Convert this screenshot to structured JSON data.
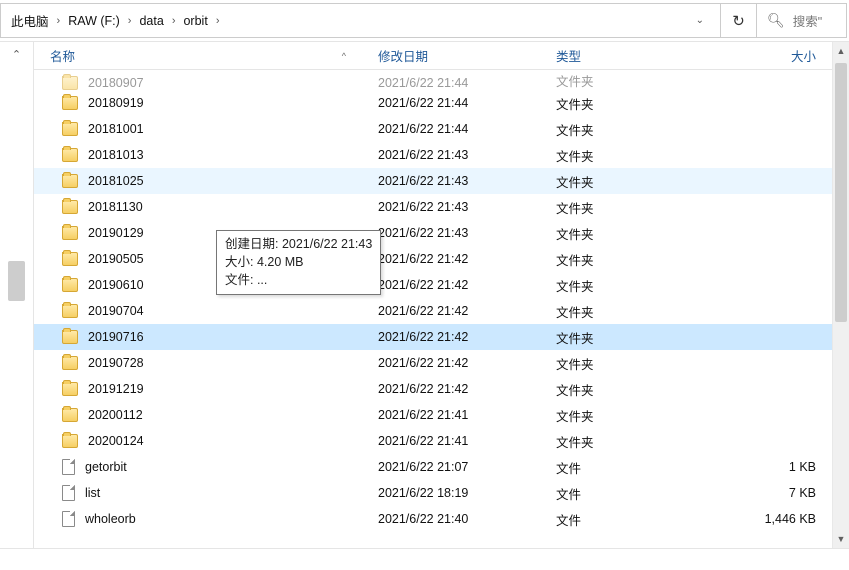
{
  "breadcrumb": {
    "items": [
      "此电脑",
      "RAW (F:)",
      "data",
      "orbit"
    ],
    "separator": "›"
  },
  "toolbar": {
    "refresh_icon": "refresh-icon",
    "search_placeholder": "搜索\""
  },
  "columns": {
    "name": "名称",
    "date": "修改日期",
    "type": "类型",
    "size": "大小",
    "sort_indicator": "^"
  },
  "tooltip": {
    "line1": "创建日期: 2021/6/22 21:43",
    "line2": "大小: 4.20 MB",
    "line3": "文件: ..."
  },
  "files": [
    {
      "icon": "folder",
      "name": "20180907",
      "date": "2021/6/22 21:44",
      "type": "文件夹",
      "size": "",
      "cutTop": true
    },
    {
      "icon": "folder",
      "name": "20180919",
      "date": "2021/6/22 21:44",
      "type": "文件夹",
      "size": ""
    },
    {
      "icon": "folder",
      "name": "20181001",
      "date": "2021/6/22 21:44",
      "type": "文件夹",
      "size": ""
    },
    {
      "icon": "folder",
      "name": "20181013",
      "date": "2021/6/22 21:43",
      "type": "文件夹",
      "size": ""
    },
    {
      "icon": "folder",
      "name": "20181025",
      "date": "2021/6/22 21:43",
      "type": "文件夹",
      "size": "",
      "hl": "light"
    },
    {
      "icon": "folder",
      "name": "20181130",
      "date": "2021/6/22 21:43",
      "type": "文件夹",
      "size": ""
    },
    {
      "icon": "folder",
      "name": "20190129",
      "date": "2021/6/22 21:43",
      "type": "文件夹",
      "size": ""
    },
    {
      "icon": "folder",
      "name": "20190505",
      "date": "2021/6/22 21:42",
      "type": "文件夹",
      "size": ""
    },
    {
      "icon": "folder",
      "name": "20190610",
      "date": "2021/6/22 21:42",
      "type": "文件夹",
      "size": ""
    },
    {
      "icon": "folder",
      "name": "20190704",
      "date": "2021/6/22 21:42",
      "type": "文件夹",
      "size": ""
    },
    {
      "icon": "folder",
      "name": "20190716",
      "date": "2021/6/22 21:42",
      "type": "文件夹",
      "size": "",
      "hl": "sel"
    },
    {
      "icon": "folder",
      "name": "20190728",
      "date": "2021/6/22 21:42",
      "type": "文件夹",
      "size": ""
    },
    {
      "icon": "folder",
      "name": "20191219",
      "date": "2021/6/22 21:42",
      "type": "文件夹",
      "size": ""
    },
    {
      "icon": "folder",
      "name": "20200112",
      "date": "2021/6/22 21:41",
      "type": "文件夹",
      "size": ""
    },
    {
      "icon": "folder",
      "name": "20200124",
      "date": "2021/6/22 21:41",
      "type": "文件夹",
      "size": ""
    },
    {
      "icon": "file",
      "name": "getorbit",
      "date": "2021/6/22 21:07",
      "type": "文件",
      "size": "1 KB"
    },
    {
      "icon": "file",
      "name": "list",
      "date": "2021/6/22 18:19",
      "type": "文件",
      "size": "7 KB"
    },
    {
      "icon": "file",
      "name": "wholeorb",
      "date": "2021/6/22 21:40",
      "type": "文件",
      "size": "1,446 KB"
    }
  ],
  "footer": {
    "text": ""
  }
}
